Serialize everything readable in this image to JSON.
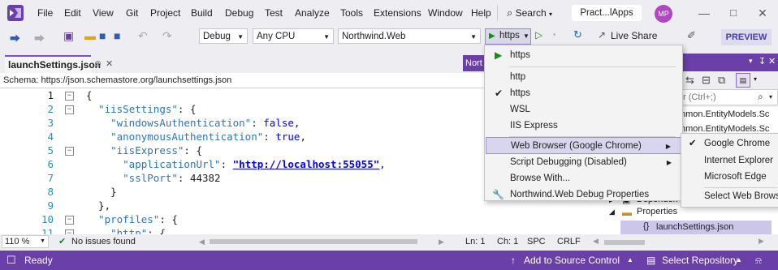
{
  "colors": {
    "accent": "#6a3fa8",
    "run_green": "#1a8a1a",
    "avatar": "#b146c2"
  },
  "menu": [
    "File",
    "Edit",
    "View",
    "Git",
    "Project",
    "Build",
    "Debug",
    "Test",
    "Analyze",
    "Tools",
    "Extensions",
    "Window",
    "Help"
  ],
  "search_label": "Search",
  "solution_name": "Pract...lApps",
  "avatar_initials": "MP",
  "toolbar": {
    "config": "Debug",
    "platform": "Any CPU",
    "startup_project": "Northwind.Web",
    "run_profile": "https",
    "live_share": "Live Share",
    "preview": "PREVIEW"
  },
  "editor": {
    "tab_title": "launchSettings.json",
    "tab_pin": "⊕",
    "schema_label": "Schema:",
    "schema_url": "https://json.schemastore.org/launchsettings.json",
    "truncated_tab": "Nort",
    "lines": [
      {
        "n": "1",
        "html": "{"
      },
      {
        "n": "2",
        "html": "  <span class=\"k\">\"iisSettings\"</span>: {"
      },
      {
        "n": "3",
        "html": "    <span class=\"k\">\"windowsAuthentication\"</span>: <span class=\"b\">false</span>,"
      },
      {
        "n": "4",
        "html": "    <span class=\"k\">\"anonymousAuthentication\"</span>: <span class=\"b\">true</span>,"
      },
      {
        "n": "5",
        "html": "    <span class=\"k\">\"iisExpress\"</span>: {"
      },
      {
        "n": "6",
        "html": "      <span class=\"k\">\"applicationUrl\"</span>: <span class=\"u\">\"http://localhost:55055\"</span>,"
      },
      {
        "n": "7",
        "html": "      <span class=\"k\">\"sslPort\"</span>: 44382"
      },
      {
        "n": "8",
        "html": "    }"
      },
      {
        "n": "9",
        "html": "  },"
      },
      {
        "n": "10",
        "html": "  <span class=\"k\">\"profiles\"</span>: {"
      },
      {
        "n": "11",
        "html": "    <span class=\"k\">\"http\"</span>: {"
      }
    ]
  },
  "editor_status": {
    "zoom": "110 %",
    "issues": "No issues found",
    "line": "Ln: 1",
    "col": "Ch: 1",
    "spc": "SPC",
    "eol": "CRLF"
  },
  "dropdown": {
    "top_item": "https",
    "items": [
      {
        "label": "http",
        "checked": false
      },
      {
        "label": "https",
        "checked": true
      },
      {
        "label": "WSL",
        "checked": false
      },
      {
        "label": "IIS Express",
        "checked": false
      }
    ],
    "web_browser": "Web Browser (Google Chrome)",
    "script_debugging": "Script Debugging (Disabled)",
    "browse_with": "Browse With...",
    "debug_properties": "Northwind.Web Debug Properties"
  },
  "submenu": {
    "items": [
      "Google Chrome",
      "Internet Explorer",
      "Microsoft Edge"
    ],
    "checked": "Google Chrome",
    "select": "Select Web Browser"
  },
  "solution_explorer": {
    "search_placeholder": "r (Ctrl+;)",
    "rows": [
      "nmon.EntityModels.Sc",
      "nmon.EntityModels.Sc"
    ],
    "dependencies": "Dependen",
    "properties": "Properties",
    "launch_file": "launchSettings.json"
  },
  "statusbar": {
    "ready": "Ready",
    "add_source": "Add to Source Control",
    "select_repo": "Select Repository"
  }
}
